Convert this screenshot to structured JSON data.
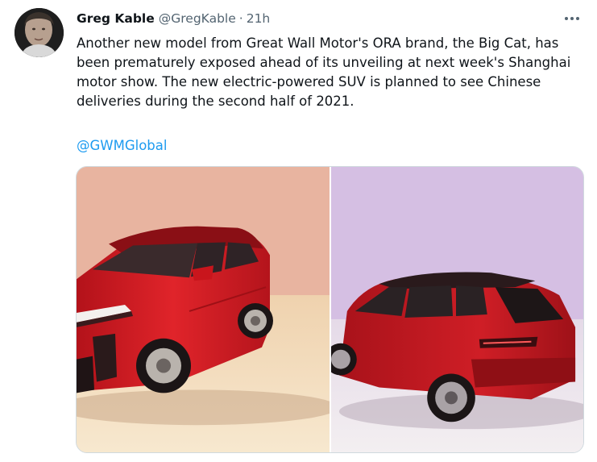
{
  "tweet": {
    "author_name": "Greg Kable",
    "author_handle": "@GregKable",
    "separator": "·",
    "timestamp": "21h",
    "body": "Another new model from Great Wall Motor's ORA brand, the Big Cat, has\nbeen prematurely exposed ahead of its unveiling at next week's Shanghai\nmotor show. The new electric-powered SUV  is planned to see Chinese\ndeliveries during the second half of 2021.",
    "mention": "@GWMGlobal"
  },
  "icons": {
    "more": "more-horizontal-icon"
  },
  "colors": {
    "link": "#1d9bf0",
    "secondary_text": "#536471",
    "car_red": "#c8151d"
  }
}
